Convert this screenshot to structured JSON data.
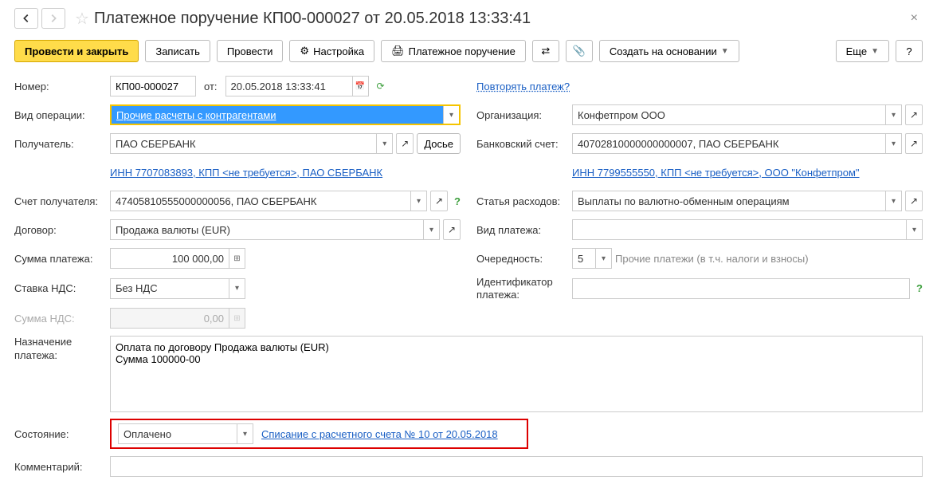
{
  "header": {
    "title": "Платежное поручение КП00-000027 от 20.05.2018 13:33:41"
  },
  "toolbar": {
    "post_close": "Провести и закрыть",
    "save": "Записать",
    "post": "Провести",
    "settings": "Настройка",
    "print": "Платежное поручение",
    "create_based": "Создать на основании",
    "more": "Еще"
  },
  "left": {
    "number_label": "Номер:",
    "number_value": "КП00-000027",
    "date_label": "от:",
    "date_value": "20.05.2018 13:33:41",
    "op_type_label": "Вид операции:",
    "op_type_value": "Прочие расчеты с контрагентами",
    "payee_label": "Получатель:",
    "payee_value": "ПАО СБЕРБАНК",
    "dossier_btn": "Досье",
    "inn_link": "ИНН 7707083893, КПП <не требуется>, ПАО СБЕРБАНК",
    "payee_acc_label": "Счет получателя:",
    "payee_acc_value": "47405810555000000056, ПАО СБЕРБАНК",
    "contract_label": "Договор:",
    "contract_value": "Продажа валюты (EUR)",
    "sum_label": "Сумма платежа:",
    "sum_value": "100 000,00",
    "vat_rate_label": "Ставка НДС:",
    "vat_rate_value": "Без НДС",
    "vat_sum_label": "Сумма НДС:",
    "vat_sum_value": "0,00"
  },
  "right": {
    "repeat_link": "Повторять платеж?",
    "org_label": "Организация:",
    "org_value": "Конфетпром ООО",
    "bank_acc_label": "Банковский счет:",
    "bank_acc_value": "40702810000000000007, ПАО СБЕРБАНК",
    "inn_link": "ИНН 7799555550, КПП <не требуется>, ООО \"Конфетпром\"",
    "expense_label": "Статья расходов:",
    "expense_value": "Выплаты по валютно-обменным операциям",
    "pay_type_label": "Вид платежа:",
    "pay_type_value": "",
    "priority_label": "Очередность:",
    "priority_value": "5",
    "priority_hint": "Прочие платежи (в т.ч. налоги и взносы)",
    "pay_id_label": "Идентификатор платежа:",
    "pay_id_value": ""
  },
  "bottom": {
    "purpose_label": "Назначение платежа:",
    "purpose_value": "Оплата по договору Продажа валюты (EUR)\nСумма 100000-00",
    "status_label": "Состояние:",
    "status_value": "Оплачено",
    "status_link": "Списание с расчетного счета № 10 от 20.05.2018",
    "comment_label": "Комментарий:",
    "comment_value": ""
  }
}
